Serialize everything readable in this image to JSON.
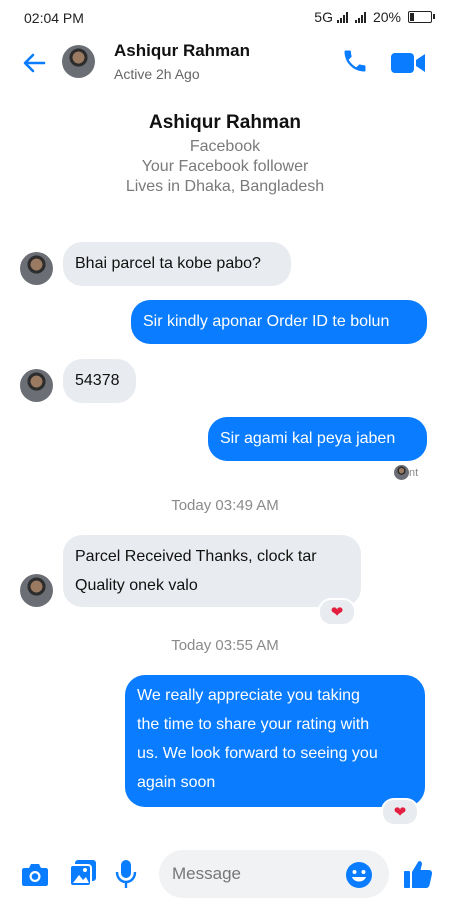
{
  "status": {
    "time": "02:04 PM",
    "network": "5G",
    "battery": "20%",
    "battery_level": 0.2
  },
  "header": {
    "name": "Ashiqur Rahman",
    "active": "Active 2h Ago"
  },
  "profile": {
    "name": "Ashiqur Rahman",
    "line1": "Facebook",
    "line2": "Your Facebook follower",
    "line3": "Lives in Dhaka, Bangladesh"
  },
  "messages": {
    "m1": "Bhai parcel ta kobe pabo?",
    "m2": "Sir kindly aponar Order ID te bolun",
    "m3": "54378",
    "m4": "Sir agami kal peya jaben",
    "seen": "nt",
    "ts1": "Today 03:49 AM",
    "m5a": "Parcel Received Thanks, clock tar",
    "m5b": "Quality onek valo",
    "ts2": "Today 03:55 AM",
    "m6a": "We really appreciate you taking",
    "m6b": "the time to share your rating with",
    "m6c": "us. We look forward to seeing you",
    "m6d": "again soon",
    "reaction": "heart"
  },
  "composer": {
    "placeholder": "Message"
  },
  "colors": {
    "accent": "#0a7cff",
    "incoming": "#e8ebef",
    "heart": "#e41e3f"
  }
}
